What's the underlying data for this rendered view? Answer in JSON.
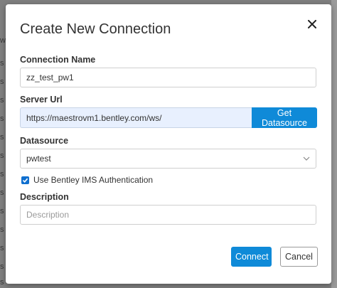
{
  "backdrop": {
    "strip_letters": [
      "w",
      "s",
      "s",
      "s",
      "s",
      "s",
      "s",
      "s",
      "s",
      "s",
      "s",
      "s",
      "s",
      "s"
    ]
  },
  "dialog": {
    "title": "Create New Connection",
    "close_icon": "close-icon",
    "connection_name": {
      "label": "Connection Name",
      "value": "zz_test_pw1"
    },
    "server_url": {
      "label": "Server Url",
      "value": "https://maestrovm1.bentley.com/ws/",
      "button_label": "Get Datasource"
    },
    "datasource": {
      "label": "Datasource",
      "selected": "pwtest",
      "icon": "chevron-down-icon"
    },
    "ims_auth": {
      "label": "Use Bentley IMS Authentication",
      "checked": true
    },
    "description": {
      "label": "Description",
      "value": "",
      "placeholder": "Description"
    },
    "buttons": {
      "connect": "Connect",
      "cancel": "Cancel"
    }
  },
  "colors": {
    "primary": "#0f8ad8",
    "url_fill": "#e8f0fe",
    "checkbox": "#0f6fcf"
  }
}
